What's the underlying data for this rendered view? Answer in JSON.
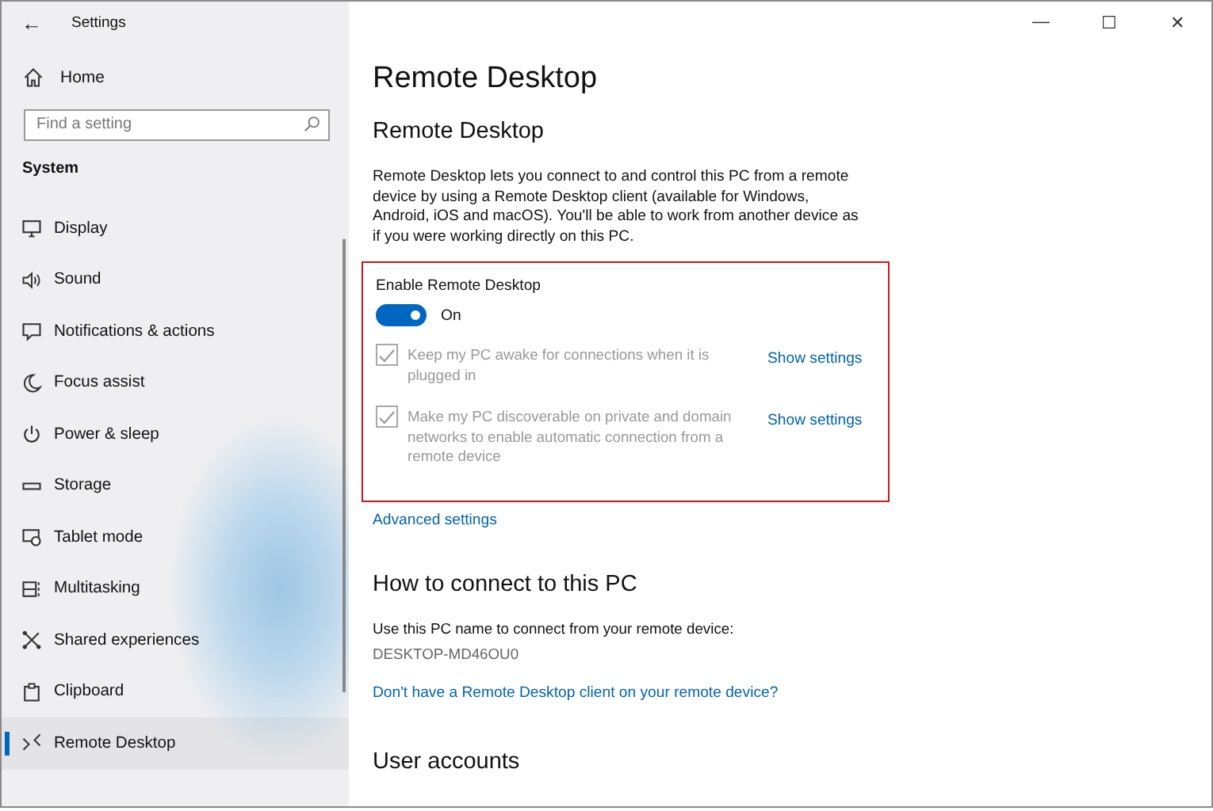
{
  "window": {
    "title": "Settings",
    "back": "←",
    "minimize": "—",
    "maximize": "☐",
    "close": "✕"
  },
  "sidebar": {
    "home": "Home",
    "search": {
      "placeholder": "Find a setting"
    },
    "section": "System",
    "items": [
      {
        "label": "Display",
        "selected": false
      },
      {
        "label": "Sound",
        "selected": false
      },
      {
        "label": "Notifications & actions",
        "selected": false
      },
      {
        "label": "Focus assist",
        "selected": false
      },
      {
        "label": "Power & sleep",
        "selected": false
      },
      {
        "label": "Storage",
        "selected": false
      },
      {
        "label": "Tablet mode",
        "selected": false
      },
      {
        "label": "Multitasking",
        "selected": false
      },
      {
        "label": "Shared experiences",
        "selected": false
      },
      {
        "label": "Clipboard",
        "selected": false
      },
      {
        "label": "Remote Desktop",
        "selected": true
      }
    ]
  },
  "main": {
    "title": "Remote Desktop",
    "section_title": "Remote Desktop",
    "description": "Remote Desktop lets you connect to and control this PC from a remote device by using a Remote Desktop client (available for Windows, Android, iOS and macOS). You'll be able to work from another device as if you were working directly on this PC.",
    "enable": {
      "label": "Enable Remote Desktop",
      "on": true,
      "state_label": "On"
    },
    "options": [
      {
        "label": "Keep my PC awake for connections when it is plugged in",
        "checked": true,
        "disabled": true,
        "link": "Show settings"
      },
      {
        "label": "Make my PC discoverable on private and domain networks to enable automatic connection from a remote device",
        "checked": true,
        "disabled": true,
        "link": "Show settings"
      }
    ],
    "advanced_link": "Advanced settings",
    "connect": {
      "title": "How to connect to this PC",
      "instruction": "Use this PC name to connect from your remote device:",
      "pc_name": "DESKTOP-MD46OU0",
      "client_link": "Don't have a Remote Desktop client on your remote device?"
    },
    "user_accounts_title": "User accounts"
  }
}
